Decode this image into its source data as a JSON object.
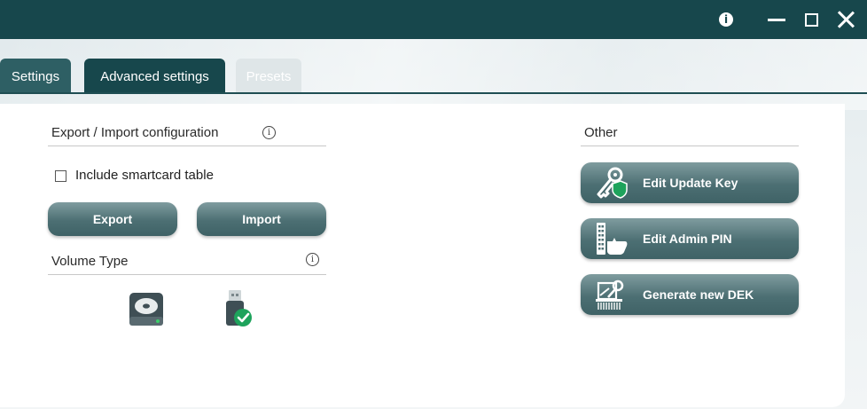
{
  "titlebar": {
    "icons": [
      "info-icon",
      "minimize-icon",
      "maximize-icon",
      "close-icon"
    ],
    "color": "#17474c"
  },
  "tabs": [
    {
      "label": "Settings",
      "active": false
    },
    {
      "label": "Advanced settings",
      "active": true
    },
    {
      "label": "Presets",
      "active": false,
      "disabled": true
    }
  ],
  "export_import": {
    "title": "Export / Import configuration",
    "checkbox_label": "Include smartcard table",
    "checkbox_checked": false,
    "export_label": "Export",
    "import_label": "Import"
  },
  "volume_type": {
    "title": "Volume Type",
    "options": [
      {
        "icon": "hard-drive-icon"
      },
      {
        "icon": "usb-drive-check-icon",
        "selected": true
      }
    ]
  },
  "other": {
    "title": "Other",
    "buttons": [
      {
        "label": "Edit Update Key",
        "icon": "key-shield-icon"
      },
      {
        "label": "Edit Admin PIN",
        "icon": "keypad-hand-icon"
      },
      {
        "label": "Generate new DEK",
        "icon": "key-shredder-icon"
      }
    ]
  },
  "colors": {
    "accent": "#17474c",
    "button": "#4c6f73",
    "success": "#1ea35c"
  }
}
